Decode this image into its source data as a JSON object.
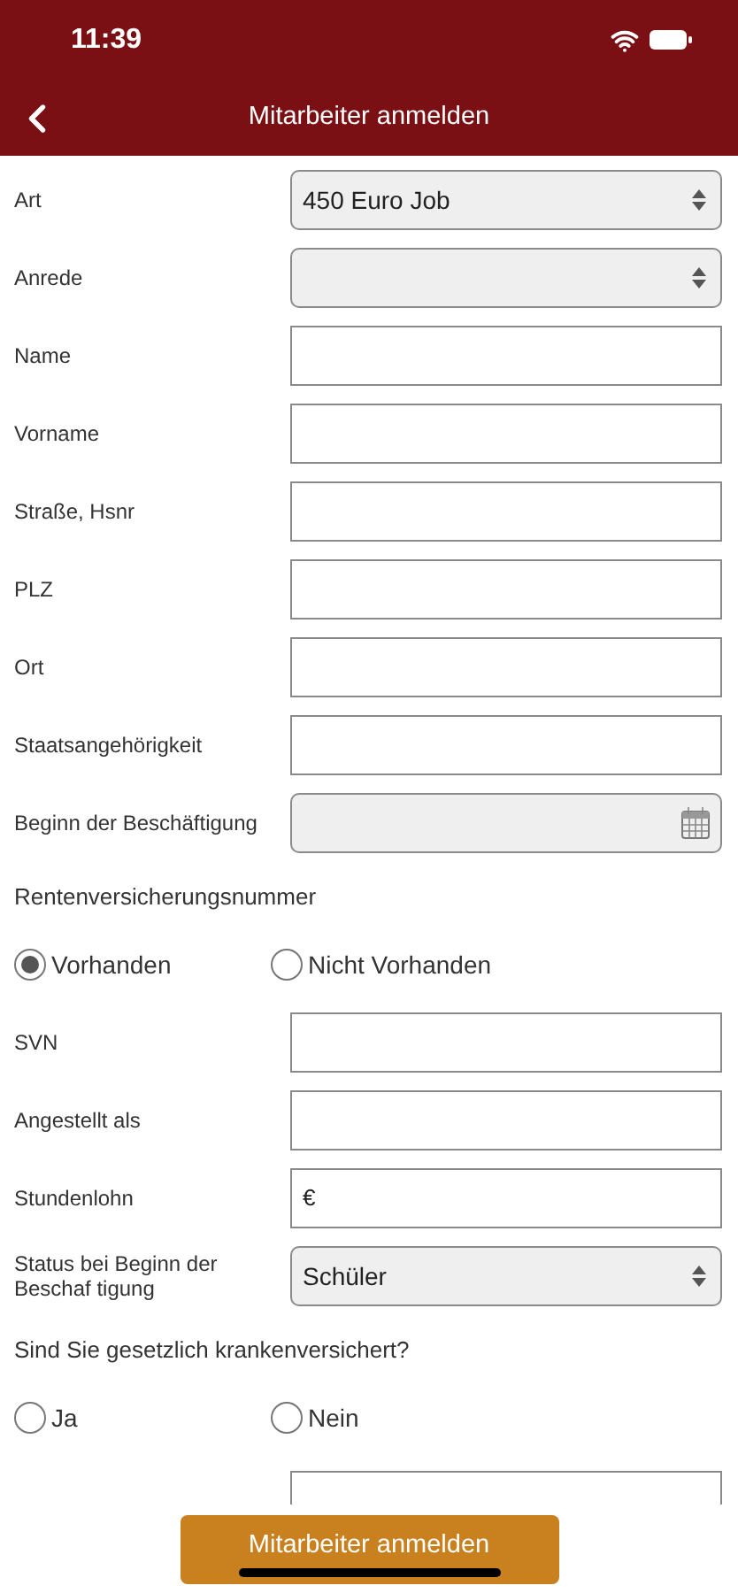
{
  "status_bar": {
    "time": "11:39"
  },
  "nav": {
    "title": "Mitarbeiter anmelden"
  },
  "fields": [
    {
      "label": "Art",
      "kind": "select",
      "value": "450 Euro Job"
    },
    {
      "label": "Anrede",
      "kind": "select"
    },
    {
      "label": "Name",
      "kind": "text"
    },
    {
      "label": "Vorname",
      "kind": "text"
    },
    {
      "label": "Straße, Hsnr",
      "kind": "text"
    },
    {
      "label": "PLZ",
      "kind": "text"
    },
    {
      "label": "Ort",
      "kind": "text"
    },
    {
      "label": "Staatsangehörigkeit",
      "kind": "text"
    },
    {
      "label": "Beginn der Beschäftigung",
      "kind": "date"
    }
  ],
  "pension": {
    "question": "Rentenversicherungsnummer",
    "options": [
      {
        "label": "Vorhanden",
        "selected": true
      },
      {
        "label": "Nicht Vorhanden",
        "selected": false
      }
    ]
  },
  "fields2": [
    {
      "label": "SVN",
      "kind": "text"
    },
    {
      "label": "Angestellt als",
      "kind": "text"
    },
    {
      "label": "Stundenlohn",
      "kind": "currency",
      "prefix": "€"
    },
    {
      "label": "Status bei Beginn der Beschaf tigung",
      "kind": "select",
      "value": "Schüler"
    }
  ],
  "insurance": {
    "question": "Sind Sie gesetzlich krankenversichert?",
    "options": [
      {
        "label": "Ja",
        "selected": false
      },
      {
        "label": "Nein",
        "selected": false
      }
    ]
  },
  "submit": {
    "label": "Mitarbeiter anmelden"
  }
}
